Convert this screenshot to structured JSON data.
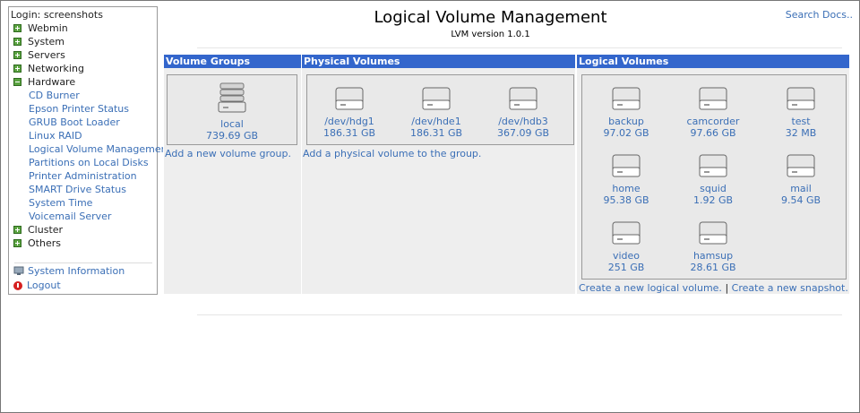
{
  "sidebar": {
    "login": "Login: screenshots",
    "categories": [
      {
        "label": "Webmin"
      },
      {
        "label": "System"
      },
      {
        "label": "Servers"
      },
      {
        "label": "Networking"
      },
      {
        "label": "Hardware"
      }
    ],
    "hardware_items": [
      "CD Burner",
      "Epson Printer Status",
      "GRUB Boot Loader",
      "Linux RAID",
      "Logical Volume Management",
      "Partitions on Local Disks",
      "Printer Administration",
      "SMART Drive Status",
      "System Time",
      "Voicemail Server"
    ],
    "after_categories": [
      {
        "label": "Cluster"
      },
      {
        "label": "Others"
      }
    ],
    "system_information": "System Information",
    "logout": "Logout"
  },
  "header": {
    "title": "Logical Volume Management",
    "subtitle": "LVM version 1.0.1",
    "search_docs": "Search Docs.."
  },
  "volume_groups": {
    "heading": "Volume Groups",
    "items": [
      {
        "name": "local",
        "size": "739.69 GB"
      }
    ],
    "add_link": "Add a new volume group."
  },
  "physical_volumes": {
    "heading": "Physical Volumes",
    "items": [
      {
        "name": "/dev/hdg1",
        "size": "186.31 GB"
      },
      {
        "name": "/dev/hde1",
        "size": "186.31 GB"
      },
      {
        "name": "/dev/hdb3",
        "size": "367.09 GB"
      }
    ],
    "add_link": "Add a physical volume to the group."
  },
  "logical_volumes": {
    "heading": "Logical Volumes",
    "items": [
      {
        "name": "backup",
        "size": "97.02 GB"
      },
      {
        "name": "camcorder",
        "size": "97.66 GB"
      },
      {
        "name": "test",
        "size": "32 MB"
      },
      {
        "name": "home",
        "size": "95.38 GB"
      },
      {
        "name": "squid",
        "size": "1.92 GB"
      },
      {
        "name": "mail",
        "size": "9.54 GB"
      },
      {
        "name": "video",
        "size": "251 GB"
      },
      {
        "name": "hamsup",
        "size": "28.61 GB"
      }
    ],
    "create_link": "Create a new logical volume.",
    "separator": "|",
    "snapshot_link": "Create a new snapshot."
  },
  "icons": {
    "category": "plus-square-icon",
    "disk": "hard-disk-icon",
    "sysinfo": "system-information-icon",
    "logout": "power-icon"
  },
  "colors": {
    "accent": "#3366cc",
    "link": "#3b6fb6",
    "category_icon": "#5aa340",
    "logout_icon": "#d62020"
  }
}
